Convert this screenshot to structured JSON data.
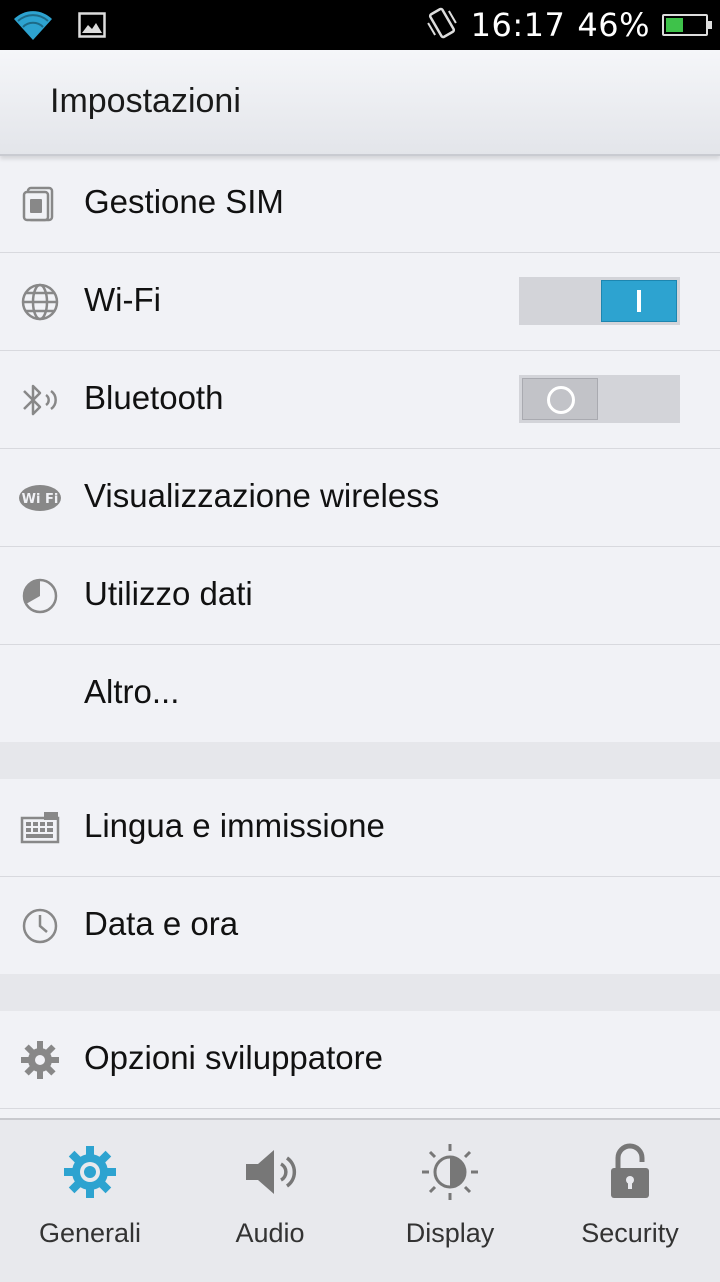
{
  "status_bar": {
    "time": "16:17",
    "battery_pct": "46%",
    "battery_level": 0.46,
    "icons": [
      "wifi-icon",
      "image-notification-icon",
      "vibrate-icon",
      "battery-icon"
    ]
  },
  "header": {
    "title": "Impostazioni"
  },
  "settings": {
    "items": [
      {
        "label": "Gestione SIM",
        "icon": "sim-card-icon"
      },
      {
        "label": "Wi-Fi",
        "icon": "globe-icon",
        "toggle": true
      },
      {
        "label": "Bluetooth",
        "icon": "bluetooth-icon",
        "toggle": false
      },
      {
        "label": "Visualizzazione wireless",
        "icon": "wifi-display-icon"
      },
      {
        "label": "Utilizzo dati",
        "icon": "data-usage-icon"
      },
      {
        "label": "Altro...",
        "icon": ""
      },
      {
        "label": "Lingua e immissione",
        "icon": "keyboard-icon"
      },
      {
        "label": "Data e ora",
        "icon": "clock-icon"
      },
      {
        "label": "Opzioni sviluppatore",
        "icon": "gear-icon"
      }
    ]
  },
  "tabs": [
    {
      "label": "Generali",
      "icon": "gear-icon",
      "active": true
    },
    {
      "label": "Audio",
      "icon": "speaker-icon",
      "active": false
    },
    {
      "label": "Display",
      "icon": "brightness-icon",
      "active": false
    },
    {
      "label": "Security",
      "icon": "lock-icon",
      "active": false
    }
  ],
  "colors": {
    "accent": "#2da3d0",
    "battery": "#3ec24a",
    "background": "#f1f2f6"
  }
}
